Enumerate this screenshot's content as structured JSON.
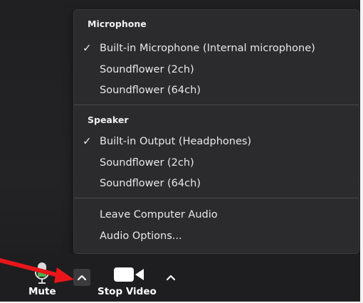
{
  "audio_menu": {
    "microphone_heading": "Microphone",
    "microphone_items": [
      {
        "label": "Built-in Microphone (Internal microphone)",
        "checked": true
      },
      {
        "label": "Soundflower (2ch)",
        "checked": false
      },
      {
        "label": "Soundflower (64ch)",
        "checked": false
      }
    ],
    "speaker_heading": "Speaker",
    "speaker_items": [
      {
        "label": "Built-in Output (Headphones)",
        "checked": true
      },
      {
        "label": "Soundflower (2ch)",
        "checked": false
      },
      {
        "label": "Soundflower (64ch)",
        "checked": false
      }
    ],
    "actions": [
      {
        "label": "Leave Computer Audio"
      },
      {
        "label": "Audio Options..."
      }
    ],
    "check_glyph": "✓"
  },
  "toolbar": {
    "mute_label": "Mute",
    "stop_video_label": "Stop Video",
    "mic_icon": "microphone-icon",
    "video_icon": "video-camera-icon",
    "caret_icon": "caret-up-icon"
  },
  "annotation": {
    "arrow_color": "#e8161b",
    "arrow_target": "audio-options-caret"
  },
  "colors": {
    "menu_bg": "#2b2b2d",
    "toolbar_bg": "#1e1e20",
    "mic_green": "#4caf50",
    "text": "#e9e9e9"
  }
}
